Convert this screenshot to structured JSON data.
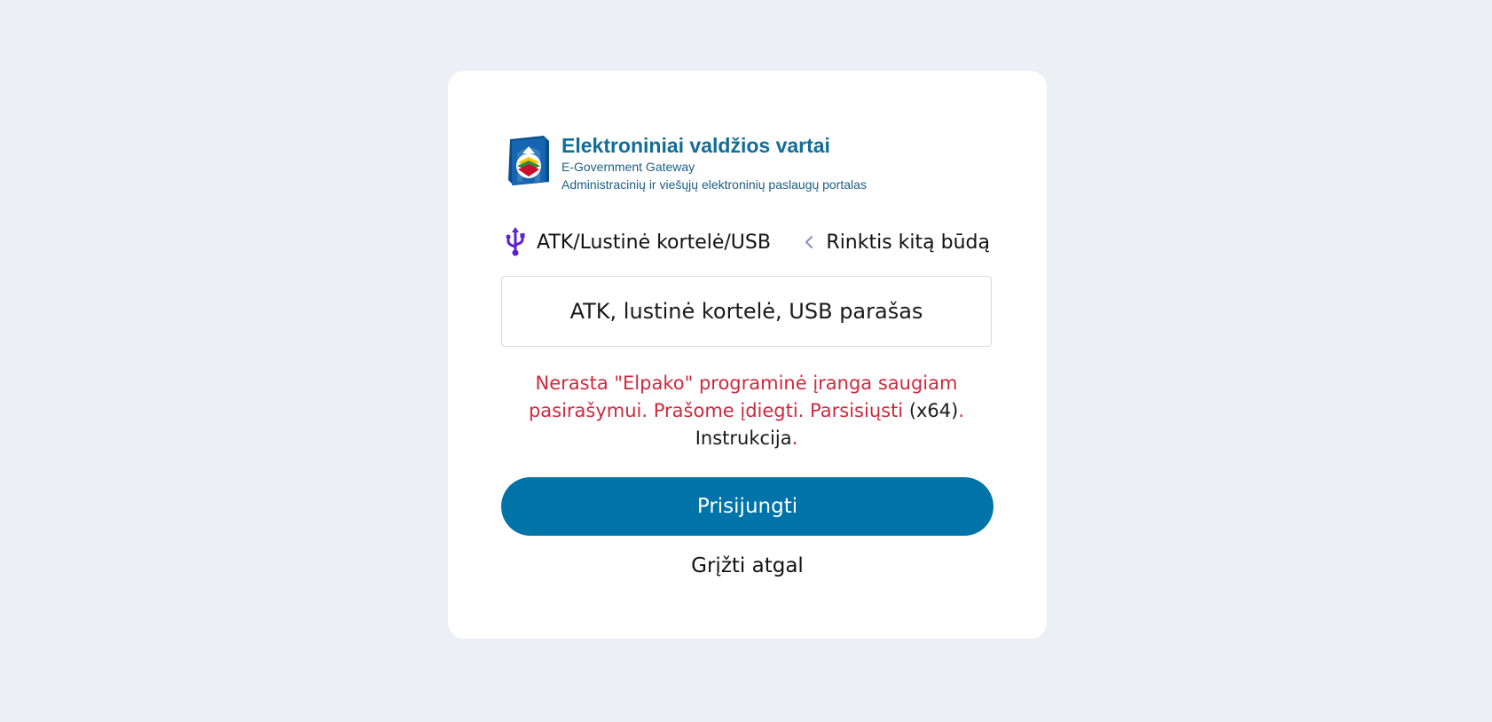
{
  "brand": {
    "title": "Elektroniniai valdžios vartai",
    "subtitle1": "E-Government Gateway",
    "subtitle2": "Administracinių ir viešųjų elektroninių paslaugų portalas"
  },
  "method": {
    "current_label": "ATK/Lustinė kortelė/USB",
    "current_icon": "usb-icon",
    "change_label": "Rinktis kitą būdą",
    "change_icon": "chevron-left-icon"
  },
  "option": {
    "label": "ATK, lustinė kortelė, USB parašas"
  },
  "error": {
    "text_part1": "Nerasta \"Elpako\" programinė įranga saugiam pasirašymui. Prašome įdiegti. ",
    "download_link": "Parsisiųsti",
    "arch": " (x64)",
    "dot1": ".",
    "instructions_link": "Instrukcija",
    "dot2": "."
  },
  "actions": {
    "login_label": "Prisijungti",
    "back_label": "Grįžti atgal"
  },
  "colors": {
    "background": "#ecf0f4",
    "primary": "#0073a8",
    "error": "#d0283c",
    "usb_icon": "#5a1fd6"
  }
}
